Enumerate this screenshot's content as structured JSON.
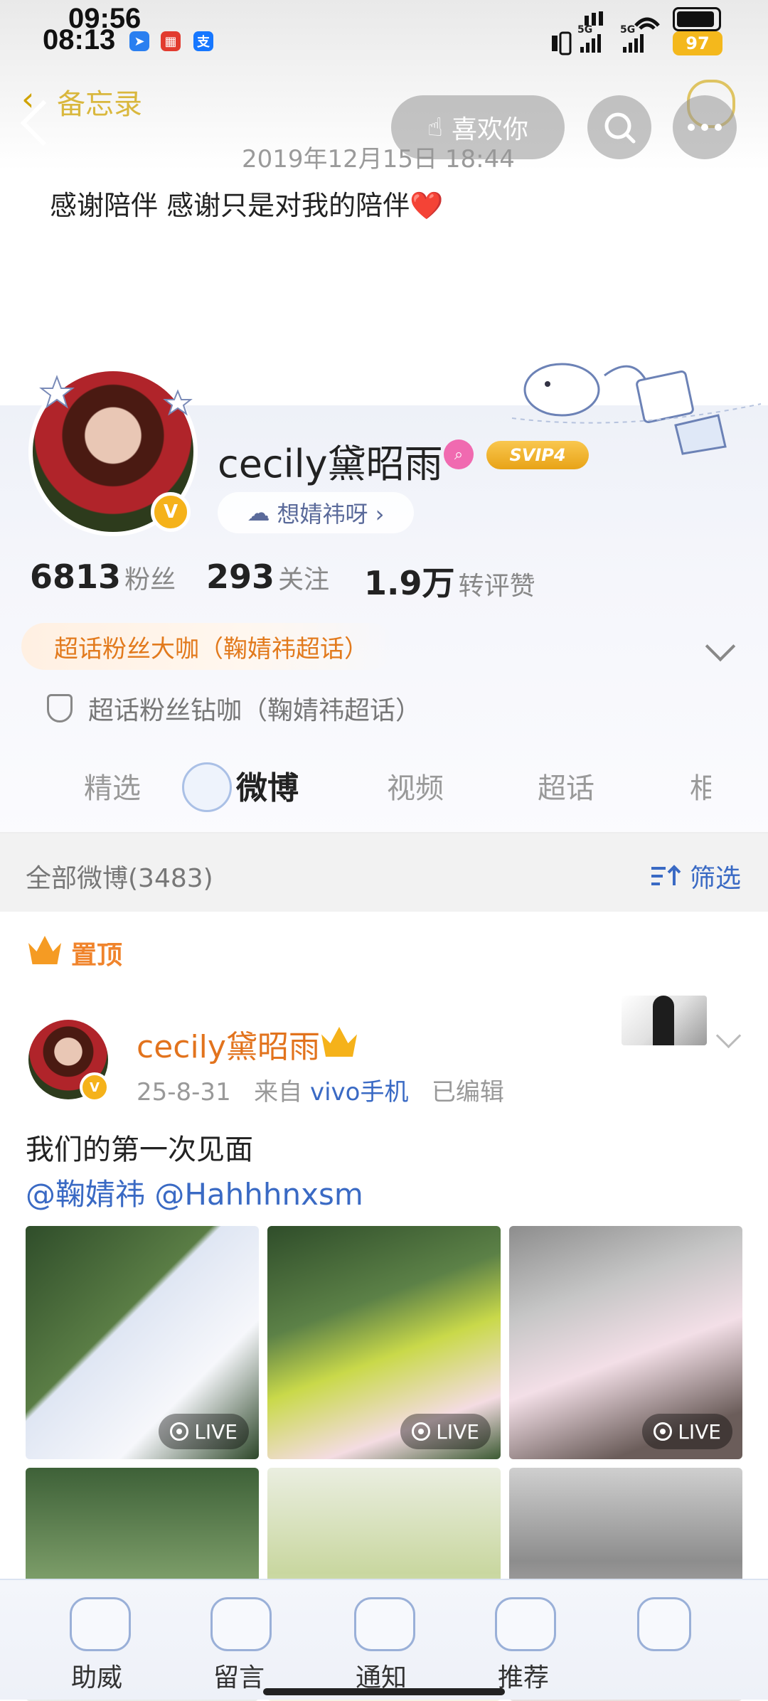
{
  "status_bar": {
    "time_overlay": "09:56",
    "time": "08:13",
    "app_icons": [
      "send-icon",
      "news-app-icon",
      "alipay-icon"
    ],
    "app_icon_labels": [
      "",
      "",
      "支"
    ],
    "app_icon_colors": [
      "#2a7ff0",
      "#e23b2f",
      "#1677ff"
    ],
    "battery": "97",
    "network_labels": [
      "5G",
      "5G"
    ]
  },
  "memo": {
    "back_label": "备忘录",
    "date": "2019年12月15日 18:44",
    "text": "感谢陪伴 感谢只是对我的陪伴❤️"
  },
  "nav": {
    "like_label": "喜欢你",
    "icons": [
      "back-icon",
      "search-icon",
      "more-icon"
    ]
  },
  "profile": {
    "name": "cecily黛昭雨",
    "vip_badge": "SVIP4",
    "verified_badge": "V",
    "bio": "想婧祎呀 ›",
    "stats": [
      {
        "number": "6813",
        "label": "粉丝"
      },
      {
        "number": "293",
        "label": "关注"
      },
      {
        "number": "1.9万",
        "label": "转评赞"
      }
    ],
    "fan_badge": "超话粉丝大咖（鞠婧祎超话）",
    "fan_sub": "超话粉丝钻咖（鞠婧祎超话）"
  },
  "tabs": [
    {
      "label": "精选",
      "active": false
    },
    {
      "label": "微博",
      "active": true
    },
    {
      "label": "视频",
      "active": false
    },
    {
      "label": "超话",
      "active": false
    },
    {
      "label": "相",
      "active": false
    }
  ],
  "feed": {
    "all_label": "全部微博(3483)",
    "filter_label": "筛选",
    "pinned_label": "置顶"
  },
  "post": {
    "author": "cecily黛昭雨",
    "date": "25-8-31",
    "source_prefix": "来自",
    "source": "vivo手机",
    "edited": "已编辑",
    "text": "我们的第一次见面",
    "mentions": "@鞠婧祎 @Hahhhnxsm",
    "live_label": "LIVE"
  },
  "bottom_bar": {
    "items": [
      {
        "label": "助威",
        "icon": "teacup-icon"
      },
      {
        "label": "留言",
        "icon": "message-bear-icon"
      },
      {
        "label": "通知",
        "icon": "bell-bottle-icon"
      },
      {
        "label": "推荐",
        "icon": "recommend-bubble-icon"
      }
    ]
  },
  "colors": {
    "accent_orange": "#e2731d",
    "link_blue": "#3a6ac4",
    "vip_gold": "#f5b21a"
  }
}
